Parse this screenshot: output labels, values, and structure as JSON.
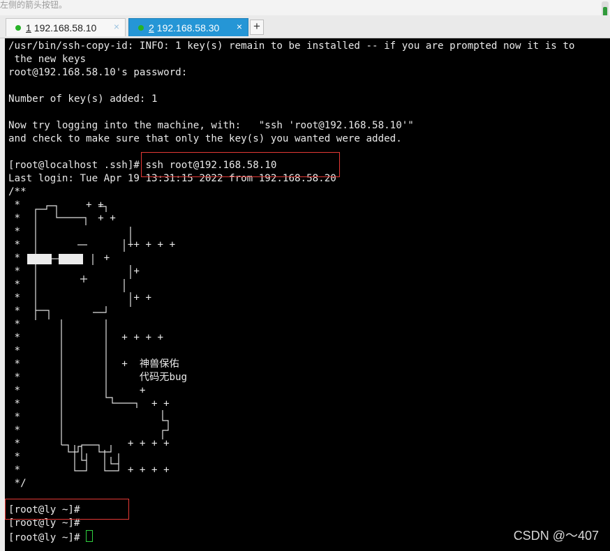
{
  "top_hint": "左侧的箭头按钮。",
  "tabs": [
    {
      "number": "1",
      "label": "192.168.58.10",
      "close": "×",
      "active": false
    },
    {
      "number": "2",
      "label": "192.168.58.30",
      "close": "×",
      "active": true
    }
  ],
  "add_tab": "+",
  "terminal": {
    "lines": [
      "/usr/bin/ssh-copy-id: INFO: 1 key(s) remain to be installed -- if you are prompted now it is to",
      " the new keys",
      "root@192.168.58.10's password:",
      "",
      "Number of key(s) added: 1",
      "",
      "Now try logging into the machine, with:   \"ssh 'root@192.168.58.10'\"",
      "and check to make sure that only the key(s) you wanted were added.",
      "",
      "[root@localhost .ssh]# ssh root@192.168.58.10",
      "Last login: Tue Apr 19 13:31:15 2022 from 192.168.58.20",
      "/**",
      " *           + +",
      " *             + +",
      " *",
      " *                  ++ + + +",
      " *              +",
      " *                   +",
      " *",
      " *                   + +",
      " *",
      " *",
      " *                 + + + +",
      " *",
      " *                 +  神兽保佑",
      " *                    代码无bug",
      " *                    +",
      " *                      + +",
      " *",
      " *",
      " *                  + + + +",
      " *",
      " *                  + + + +",
      " */",
      "",
      "[root@ly ~]#",
      "[root@ly ~]#",
      "[root@ly ~]# "
    ]
  },
  "watermark": "CSDN @～407"
}
